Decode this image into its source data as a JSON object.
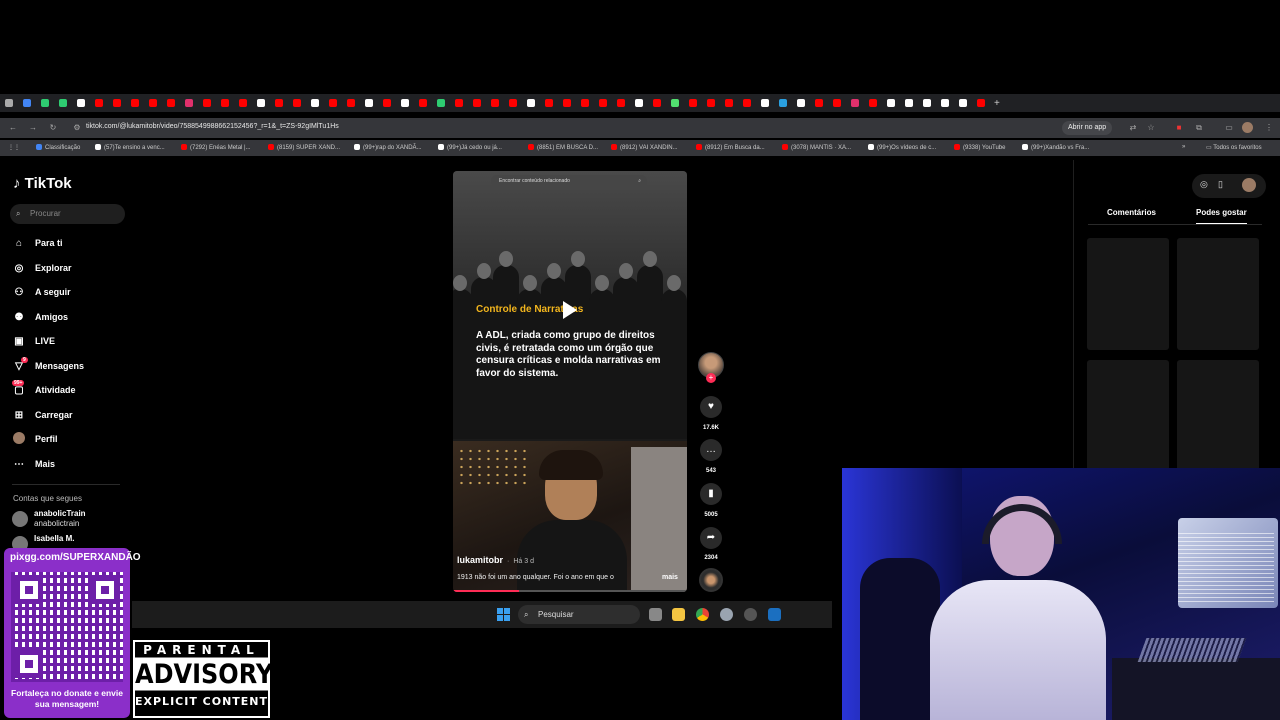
{
  "browser": {
    "url": "tiktok.com/@lukamitobr/video/7588549988662152456?_r=1&_t=ZS-92gIMlTu1Hs",
    "open_in_app": "Abrir no app",
    "bookmarks": [
      {
        "label": "Classificação",
        "color": "#4285f4"
      },
      {
        "label": "(57)Te ensino a venc...",
        "color": "#fff"
      },
      {
        "label": "(7292) Enéas Metal |...",
        "color": "#ff0000"
      },
      {
        "label": "(8159) SUPER XAND...",
        "color": "#ff0000"
      },
      {
        "label": "(99+)rap do XANDÃ...",
        "color": "#fff"
      },
      {
        "label": "(99+)Já cedo ou já...",
        "color": "#fff"
      },
      {
        "label": "(8851) EM BUSCA D...",
        "color": "#ff0000"
      },
      {
        "label": "(8912) VAI XANDIN...",
        "color": "#ff0000"
      },
      {
        "label": "(8912) Em Busca da...",
        "color": "#ff0000"
      },
      {
        "label": "(3078) MANTIS · XA...",
        "color": "#ff0000"
      },
      {
        "label": "(99+)Os vídeos de c...",
        "color": "#fff"
      },
      {
        "label": "(9338) YouTube",
        "color": "#ff0000"
      },
      {
        "label": "(99+)Xandão vs Fra...",
        "color": "#fff"
      }
    ],
    "all_favorites": "Todos os favoritos"
  },
  "tiktok": {
    "logo": "TikTok",
    "search_placeholder": "Procurar",
    "nav": [
      {
        "label": "Para ti",
        "icon": "home-icon"
      },
      {
        "label": "Explorar",
        "icon": "compass-icon"
      },
      {
        "label": "A seguir",
        "icon": "following-icon"
      },
      {
        "label": "Amigos",
        "icon": "friends-icon"
      },
      {
        "label": "LIVE",
        "icon": "live-icon"
      },
      {
        "label": "Mensagens",
        "icon": "messages-icon"
      },
      {
        "label": "Atividade",
        "icon": "activity-icon"
      },
      {
        "label": "Carregar",
        "icon": "upload-icon"
      },
      {
        "label": "Perfil",
        "icon": "profile-icon"
      },
      {
        "label": "Mais",
        "icon": "more-icon"
      }
    ],
    "messages_badge": "9",
    "activity_badge": "99+",
    "following_heading": "Contas que segues",
    "following": [
      {
        "name": "anabolicTrain",
        "handle": "anabolictrain"
      },
      {
        "name": "Isabella M.",
        "handle": ""
      }
    ],
    "video": {
      "search_placeholder": "Encontrar conteúdo relacionado",
      "title": "Controle de Narrativas",
      "body": "A ADL, criada como grupo de direitos civis, é retratada como um órgão que censura críticas e molda narrativas em favor do sistema.",
      "author": "lukamitobr",
      "time": "Há 3 d",
      "caption": "1913 não foi um ano qualquer. Foi o ano em que o",
      "more": "mais",
      "progress": 0.28
    },
    "actions": {
      "likes": "17.6K",
      "comments": "543",
      "saves": "5005",
      "shares": "2304"
    },
    "right_tabs": {
      "comments": "Comentários",
      "you_may_like": "Podes gostar"
    }
  },
  "taskbar": {
    "search": "Pesquisar"
  },
  "overlay": {
    "donate_url": "pixgg.com/SUPERXANDÃO",
    "donate_msg": "Fortaleça no donate e envie sua mensagem!",
    "advisory_top": "PARENTAL",
    "advisory_mid": "ADVISORY",
    "advisory_bottom": "EXPLICIT CONTENT"
  },
  "colors": {
    "accent": "#fe2c55",
    "title_yellow": "#f2b51d",
    "donate_purple": "#8b2fc9"
  }
}
